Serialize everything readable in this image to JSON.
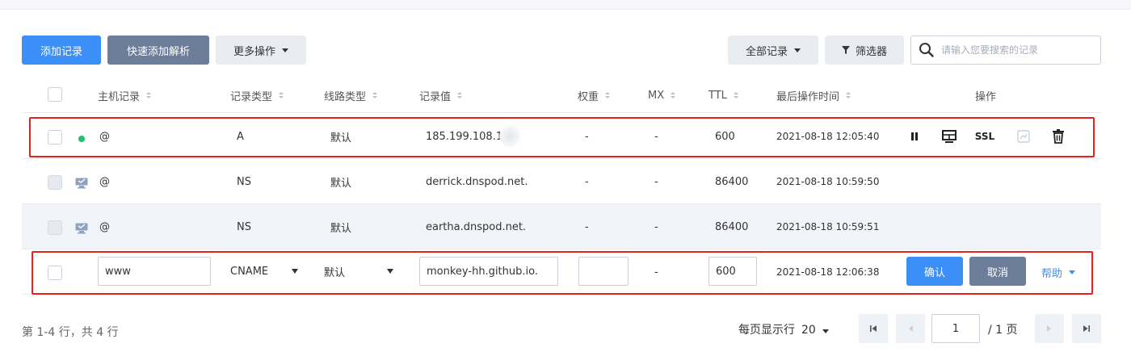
{
  "toolbar": {
    "add_record": "添加记录",
    "quick_add": "快速添加解析",
    "more_ops": "更多操作",
    "all_records": "全部记录",
    "filter": "筛选器",
    "search_placeholder": "请输入您要搜索的记录"
  },
  "table": {
    "headers": {
      "host": "主机记录",
      "type": "记录类型",
      "line": "线路类型",
      "value": "记录值",
      "weight": "权重",
      "mx": "MX",
      "ttl": "TTL",
      "updated": "最后操作时间",
      "ops": "操作"
    },
    "rows": [
      {
        "host": "@",
        "type": "A",
        "line": "默认",
        "value": "185.199.108.1",
        "weight": "-",
        "mx": "-",
        "ttl": "600",
        "updated": "2021-08-18 12:05:40",
        "status": "enabled"
      },
      {
        "host": "@",
        "type": "NS",
        "line": "默认",
        "value": "derrick.dnspod.net.",
        "weight": "-",
        "mx": "-",
        "ttl": "86400",
        "updated": "2021-08-18 10:59:50",
        "status": "system"
      },
      {
        "host": "@",
        "type": "NS",
        "line": "默认",
        "value": "eartha.dnspod.net.",
        "weight": "-",
        "mx": "-",
        "ttl": "86400",
        "updated": "2021-08-18 10:59:51",
        "status": "system"
      }
    ],
    "row_actions": {
      "ssl": "SSL"
    },
    "edit_row": {
      "host": "www",
      "type": "CNAME",
      "line": "默认",
      "value": "monkey-hh.github.io.",
      "weight": "",
      "mx": "-",
      "ttl": "600",
      "updated": "2021-08-18 12:06:38",
      "confirm": "确认",
      "cancel": "取消",
      "help": "帮助"
    }
  },
  "footer": {
    "summary": "第 1-4 行，共 4 行",
    "per_page_label": "每页显示行",
    "per_page_value": "20",
    "page": "1",
    "total_pages": "/ 1 页"
  },
  "colors": {
    "primary": "#3b8ff7",
    "slate": "#6b7d99",
    "highlight": "#e5231b",
    "status_green": "#1ec26b"
  }
}
